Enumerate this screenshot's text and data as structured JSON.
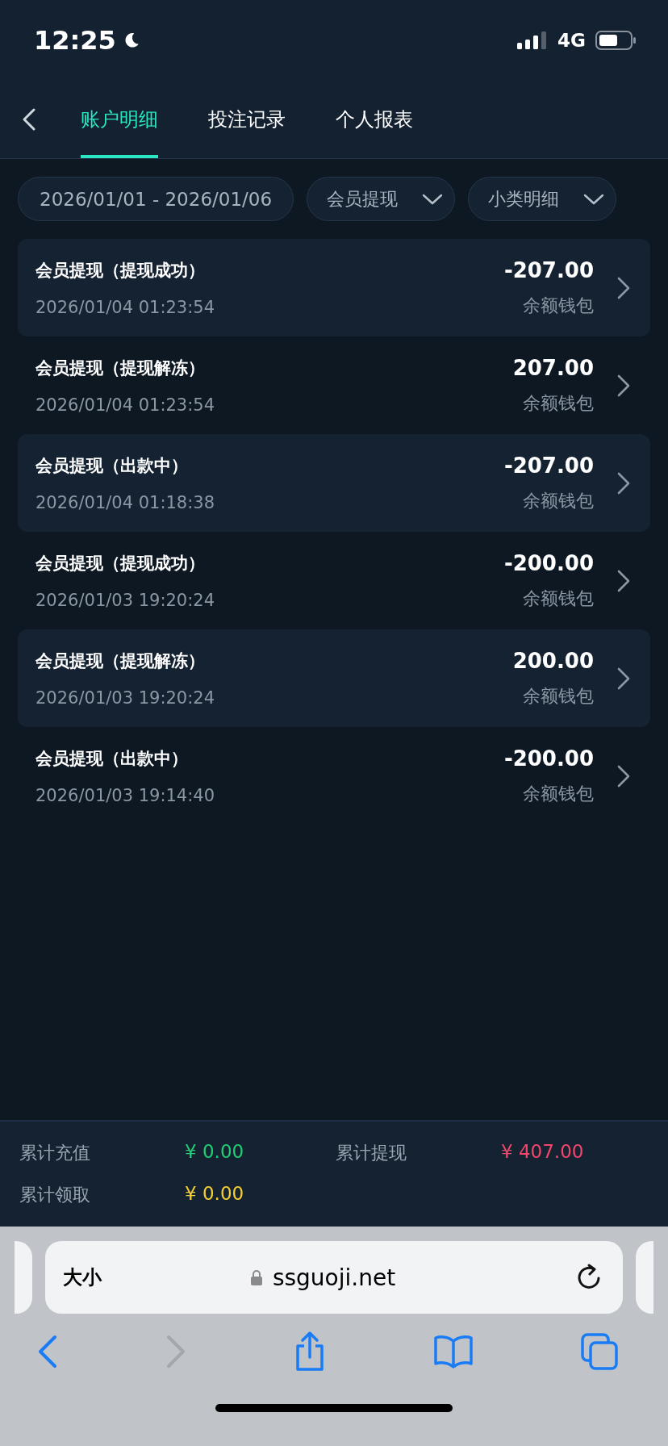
{
  "status_bar": {
    "time": "12:25",
    "network": "4G"
  },
  "tabs": [
    {
      "label": "账户明细",
      "selected": true
    },
    {
      "label": "投注记录",
      "selected": false
    },
    {
      "label": "个人报表",
      "selected": false
    }
  ],
  "filters": {
    "date_range": "2026/01/01 - 2026/01/06",
    "type": "会员提现",
    "detail": "小类明细"
  },
  "records": [
    {
      "title": "会员提现（提现成功）",
      "time": "2026/01/04 01:23:54",
      "amount": "-207.00",
      "wallet": "余额钱包"
    },
    {
      "title": "会员提现（提现解冻）",
      "time": "2026/01/04 01:23:54",
      "amount": "207.00",
      "wallet": "余额钱包"
    },
    {
      "title": "会员提现（出款中）",
      "time": "2026/01/04 01:18:38",
      "amount": "-207.00",
      "wallet": "余额钱包"
    },
    {
      "title": "会员提现（提现成功）",
      "time": "2026/01/03 19:20:24",
      "amount": "-200.00",
      "wallet": "余额钱包"
    },
    {
      "title": "会员提现（提现解冻）",
      "time": "2026/01/03 19:20:24",
      "amount": "200.00",
      "wallet": "余额钱包"
    },
    {
      "title": "会员提现（出款中）",
      "time": "2026/01/03 19:14:40",
      "amount": "-200.00",
      "wallet": "余额钱包"
    }
  ],
  "summary": [
    {
      "label": "累计充值",
      "value": "¥ 0.00",
      "color": "#1fcf74"
    },
    {
      "label": "累计提现",
      "value": "¥ 407.00",
      "color": "#f2476a"
    },
    {
      "label": "累计领取",
      "value": "¥ 0.00",
      "color": "#f5cf30"
    }
  ],
  "browser": {
    "text_size": "大小",
    "url": "ssguoji.net",
    "back_disabled": false,
    "forward_disabled": true
  }
}
